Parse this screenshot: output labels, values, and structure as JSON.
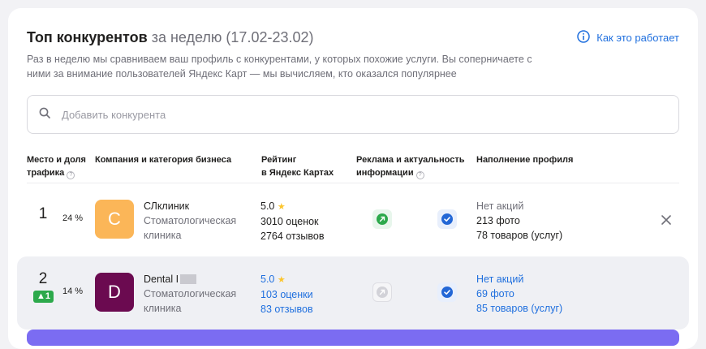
{
  "header": {
    "title": "Топ конкурентов",
    "period": "за неделю (17.02-23.02)",
    "how_link": "Как это работает",
    "description": "Раз в неделю мы сравниваем ваш профиль с конкурентами, у которых похожие услуги. Вы соперничаете с ними за внимание пользователей Яндекс Карт — мы вычисляем, кто оказался популярнее"
  },
  "search": {
    "placeholder": "Добавить конкурента",
    "value": ""
  },
  "columns": {
    "place_line1": "Место и доля",
    "place_line2": "трафика",
    "company": "Компания и категория бизнеса",
    "rating_line1": "Рейтинг",
    "rating_line2": "в Яндекс Картах",
    "ads_line1": "Реклама и актуальность",
    "ads_line2": "информации",
    "fill": "Наполнение профиля"
  },
  "rows": [
    {
      "rank": "1",
      "share": "24 %",
      "delta": "",
      "avatar_letter": "C",
      "avatar_color": "#fbb658",
      "name": "СЛклиник",
      "category": "Стоматологическая клиника",
      "rating": "5.0",
      "ratings_count": "3010 оценок",
      "reviews": "2764 отзывов",
      "promo": "Нет акций",
      "photos": "213 фото",
      "goods": "78 товаров (услуг)"
    },
    {
      "rank": "2",
      "share": "14 %",
      "delta": "1",
      "avatar_letter": "D",
      "avatar_color": "#6b0a50",
      "name": "Dental I",
      "category": "Стоматологическая клиника",
      "rating": "5.0",
      "ratings_count": "103 оценки",
      "reviews": "83 отзывов",
      "promo": "Нет акций",
      "photos": "69 фото",
      "goods": "85 товаров (услуг)"
    }
  ],
  "colors": {
    "accent": "#1f6fde",
    "positive": "#2ca94b",
    "star": "#fcc52c",
    "bottom_button": "#7b6cf2"
  },
  "icons": [
    "info-icon",
    "search-icon",
    "question-icon",
    "star-icon",
    "ad-arrow-icon",
    "verified-check-icon",
    "close-icon"
  ]
}
